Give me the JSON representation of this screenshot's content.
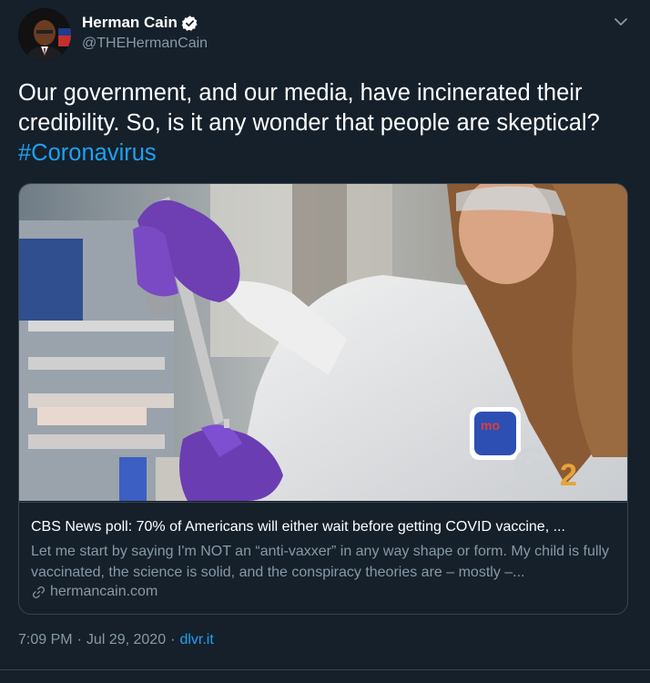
{
  "author": {
    "display_name": "Herman Cain",
    "handle": "@THEHermanCain",
    "verified": true,
    "avatar_icon": "profile-photo"
  },
  "tweet": {
    "text": "Our government, and our media, have incinerated their credibility. So, is it any wonder that people are skeptical?",
    "hashtag": "#Coronavirus"
  },
  "card": {
    "image_watermark": "2",
    "title": "CBS News poll: 70% of Americans will either wait before getting COVID vaccine, ...",
    "description": "Let me start by saying I'm NOT an “anti-vaxxer” in any way shape or form. My child is fully vaccinated, the science is solid, and the conspiracy theories are – mostly –...",
    "link_icon": "link-icon",
    "domain": "hermancain.com"
  },
  "meta": {
    "time": "7:09 PM",
    "separator": "·",
    "date": "Jul 29, 2020",
    "source": "dlvr.it"
  },
  "colors": {
    "background": "#15202b",
    "accent": "#1da1f2",
    "secondary_text": "#8899a6",
    "border": "#38444d"
  }
}
